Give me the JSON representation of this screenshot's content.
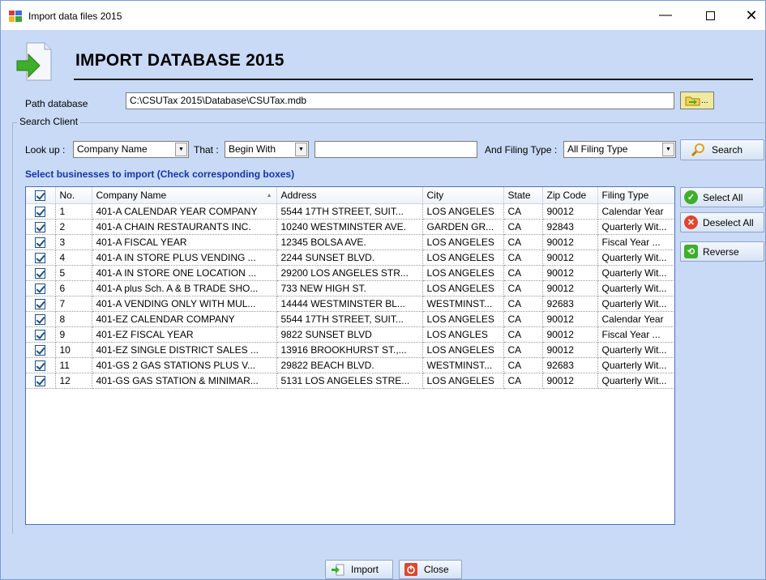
{
  "window": {
    "title": "Import data files 2015",
    "controls": {
      "minimize": "—",
      "close": "✕"
    }
  },
  "header": {
    "title": "IMPORT DATABASE 2015"
  },
  "path": {
    "label": "Path database",
    "value": "C:\\CSUTax 2015\\Database\\CSUTax.mdb"
  },
  "search": {
    "group_label": "Search Client",
    "lookup_label": "Look up :",
    "lookup_value": "Company Name",
    "that_label": "That :",
    "that_value": "Begin With",
    "text_value": "",
    "filing_label": "And Filing Type :",
    "filing_value": "All Filing Type",
    "search_button": "Search"
  },
  "instruction": "Select businesses to import (Check corresponding boxes)",
  "grid": {
    "columns": [
      "No.",
      "Company Name",
      "Address",
      "City",
      "State",
      "Zip Code",
      "Filing Type"
    ],
    "rows": [
      {
        "checked": true,
        "no": "1",
        "company": "401-A CALENDAR YEAR COMPANY",
        "address": "5544 17TH STREET, SUIT...",
        "city": "LOS ANGELES",
        "state": "CA",
        "zip": "90012",
        "filing": "Calendar Year"
      },
      {
        "checked": true,
        "no": "2",
        "company": "401-A CHAIN RESTAURANTS INC.",
        "address": "10240 WESTMINSTER AVE.",
        "city": "GARDEN GR...",
        "state": "CA",
        "zip": "92843",
        "filing": "Quarterly Wit..."
      },
      {
        "checked": true,
        "no": "3",
        "company": "401-A FISCAL YEAR",
        "address": "12345 BOLSA AVE.",
        "city": "LOS ANGELES",
        "state": "CA",
        "zip": "90012",
        "filing": "Fiscal Year ..."
      },
      {
        "checked": true,
        "no": "4",
        "company": "401-A IN STORE  PLUS VENDING ...",
        "address": "2244 SUNSET BLVD.",
        "city": "LOS ANGELES",
        "state": "CA",
        "zip": "90012",
        "filing": "Quarterly Wit..."
      },
      {
        "checked": true,
        "no": "5",
        "company": "401-A IN STORE ONE LOCATION ...",
        "address": "29200 LOS ANGELES STR...",
        "city": "LOS ANGELES",
        "state": "CA",
        "zip": "90012",
        "filing": "Quarterly Wit..."
      },
      {
        "checked": true,
        "no": "6",
        "company": "401-A plus Sch. A & B TRADE SHO...",
        "address": "733 NEW HIGH ST.",
        "city": "LOS ANGELES",
        "state": "CA",
        "zip": "90012",
        "filing": "Quarterly Wit..."
      },
      {
        "checked": true,
        "no": "7",
        "company": "401-A VENDING ONLY WITH MUL...",
        "address": "14444 WESTMINSTER BL...",
        "city": "WESTMINST...",
        "state": "CA",
        "zip": "92683",
        "filing": "Quarterly Wit..."
      },
      {
        "checked": true,
        "no": "8",
        "company": "401-EZ CALENDAR COMPANY",
        "address": "5544 17TH STREET, SUIT...",
        "city": "LOS ANGELES",
        "state": "CA",
        "zip": "90012",
        "filing": "Calendar Year"
      },
      {
        "checked": true,
        "no": "9",
        "company": "401-EZ FISCAL YEAR",
        "address": "9822 SUNSET BLVD",
        "city": "LOS ANGLES",
        "state": "CA",
        "zip": "90012",
        "filing": "Fiscal Year ..."
      },
      {
        "checked": true,
        "no": "10",
        "company": "401-EZ SINGLE DISTRICT SALES ...",
        "address": "13916 BROOKHURST ST.,...",
        "city": "LOS ANGELES",
        "state": "CA",
        "zip": "90012",
        "filing": "Quarterly Wit..."
      },
      {
        "checked": true,
        "no": "11",
        "company": "401-GS 2 GAS STATIONS PLUS V...",
        "address": "29822 BEACH BLVD.",
        "city": "WESTMINST...",
        "state": "CA",
        "zip": "92683",
        "filing": "Quarterly Wit..."
      },
      {
        "checked": true,
        "no": "12",
        "company": "401-GS GAS STATION & MINIMAR...",
        "address": "5131 LOS ANGELES STRE...",
        "city": "LOS ANGELES",
        "state": "CA",
        "zip": "90012",
        "filing": "Quarterly Wit..."
      }
    ]
  },
  "side_buttons": {
    "select_all": "Select All",
    "deselect_all": "Deselect All",
    "reverse": "Reverse"
  },
  "bottom_buttons": {
    "import": "Import",
    "close": "Close"
  },
  "colors": {
    "background": "#c8daf6",
    "instruction": "#1336a8",
    "grid_border": "#4a6fb5"
  }
}
